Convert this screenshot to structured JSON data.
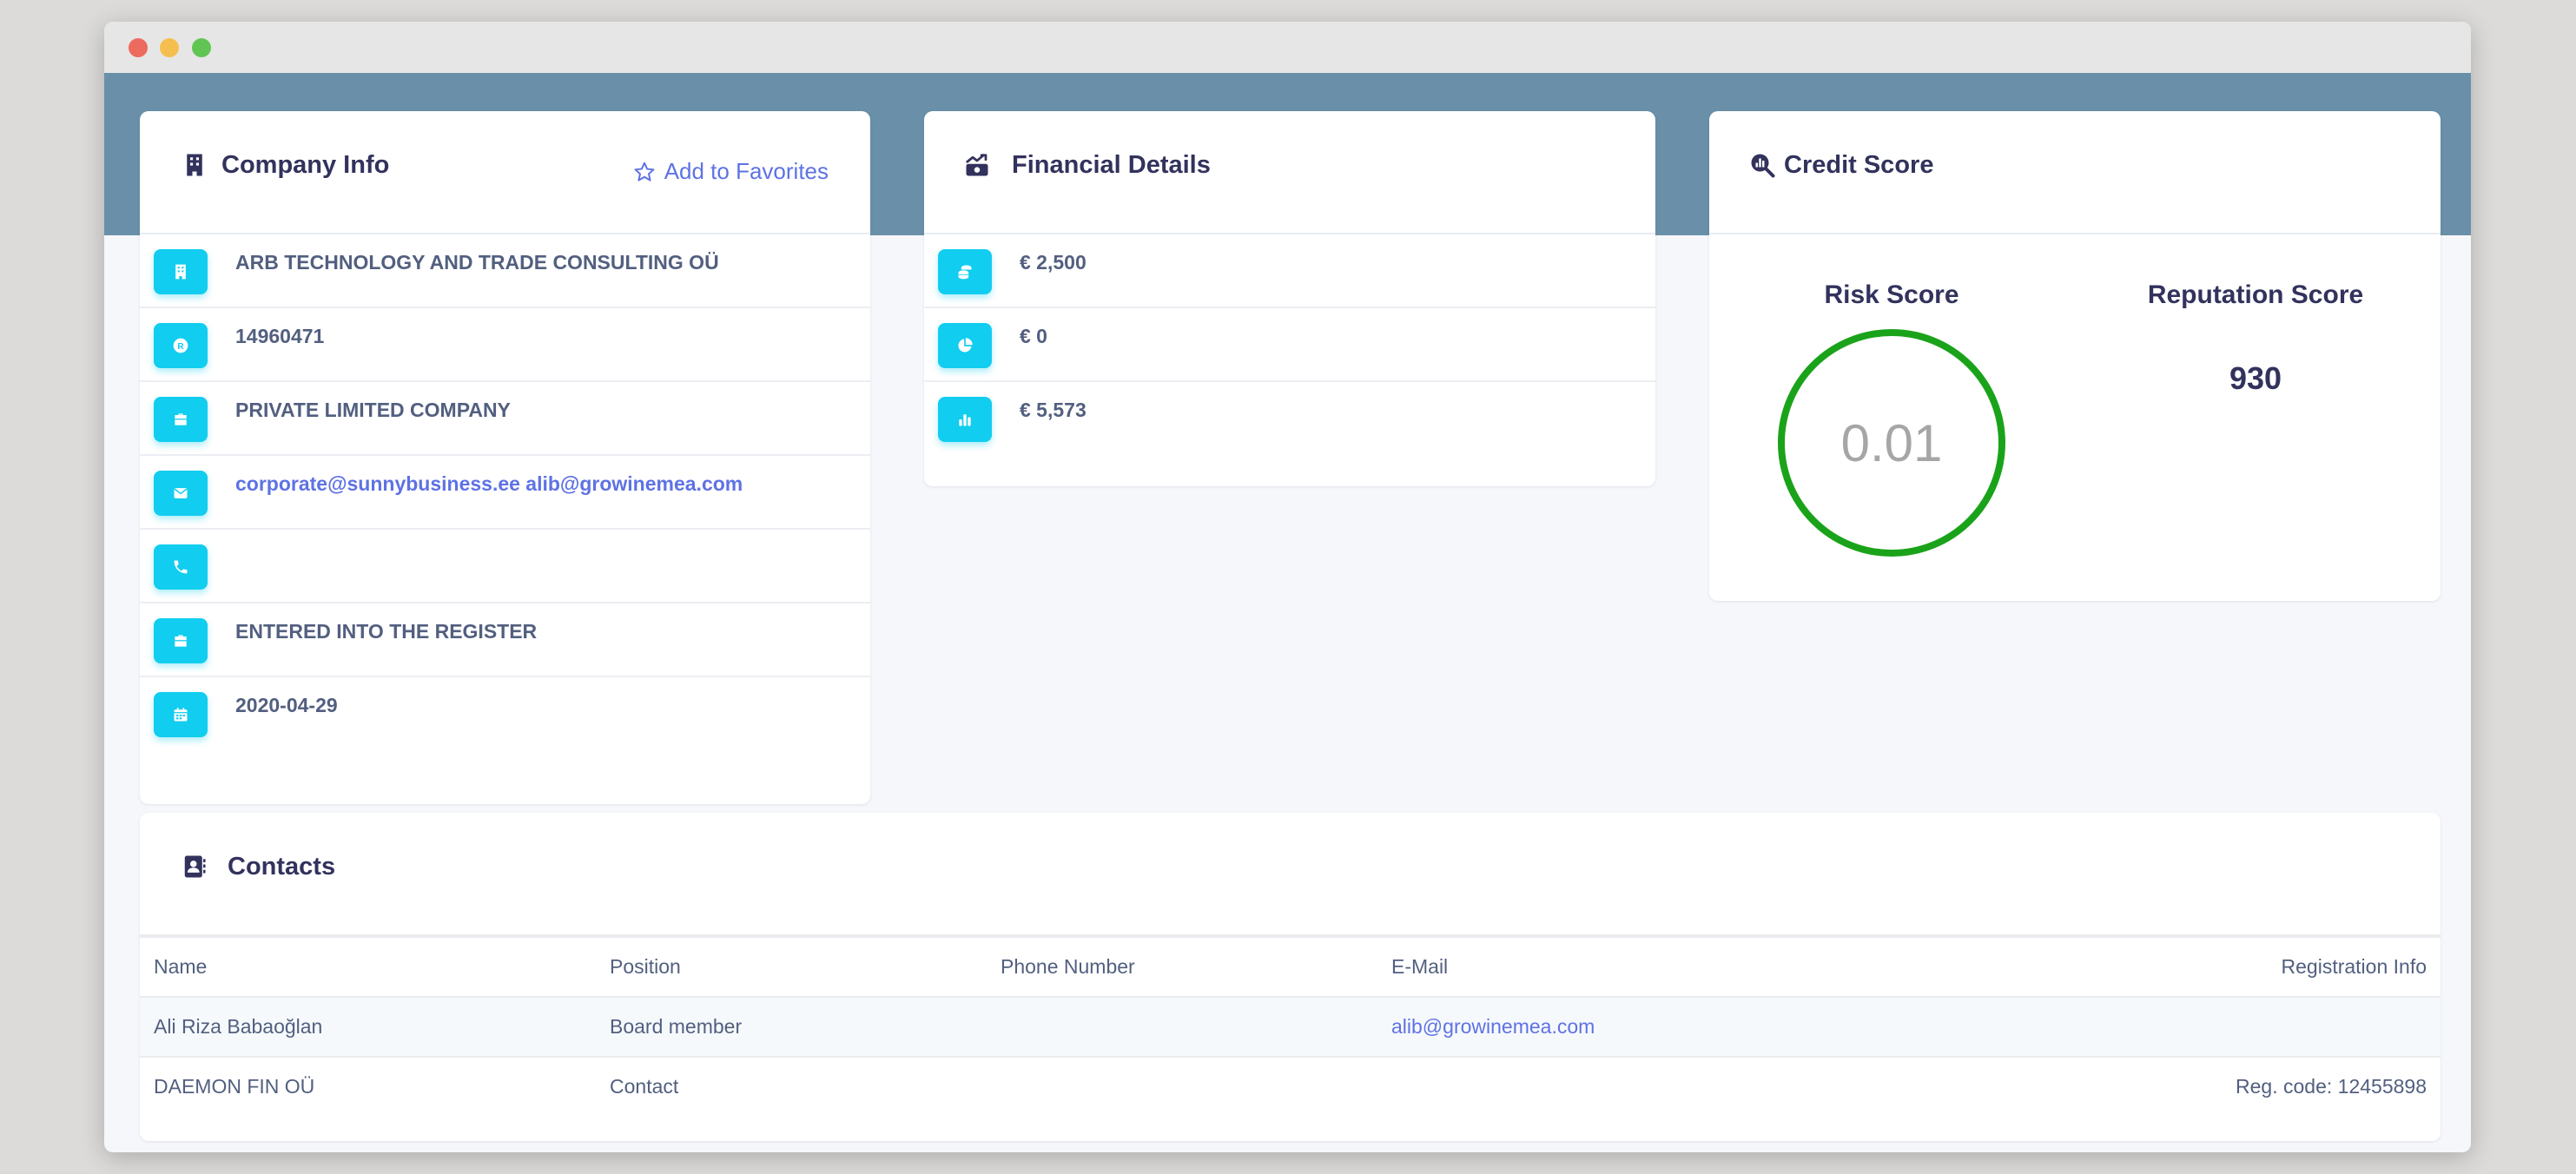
{
  "company_info": {
    "title": "Company Info",
    "favorite_label": "Add to Favorites",
    "rows": [
      {
        "icon": "building-icon",
        "value": "ARB TECHNOLOGY AND TRADE CONSULTING OÜ"
      },
      {
        "icon": "registered-icon",
        "value": "14960471"
      },
      {
        "icon": "briefcase-icon",
        "value": "PRIVATE LIMITED COMPANY"
      },
      {
        "icon": "envelope-icon",
        "value": "corporate@sunnybusiness.ee alib@growinemea.com"
      },
      {
        "icon": "phone-icon",
        "value": ""
      },
      {
        "icon": "briefcase-icon",
        "value": "ENTERED INTO THE REGISTER"
      },
      {
        "icon": "calendar-icon",
        "value": "2020-04-29"
      }
    ]
  },
  "financial_details": {
    "title": "Financial Details",
    "rows": [
      {
        "icon": "coins-icon",
        "value": "€ 2,500"
      },
      {
        "icon": "pie-chart-icon",
        "value": "€ 0"
      },
      {
        "icon": "bar-chart-icon",
        "value": "€ 5,573"
      }
    ]
  },
  "credit_score": {
    "title": "Credit Score",
    "risk_label": "Risk Score",
    "risk_value": "0.01",
    "reputation_label": "Reputation Score",
    "reputation_value": "930"
  },
  "contacts": {
    "title": "Contacts",
    "columns": [
      "Name",
      "Position",
      "Phone Number",
      "E-Mail",
      "Registration Info"
    ],
    "rows": [
      {
        "name": "Ali Riza Babaoğlan",
        "position": "Board member",
        "phone": "",
        "email": "alib@growinemea.com",
        "registration": ""
      },
      {
        "name": "DAEMON FIN OÜ",
        "position": "Contact",
        "phone": "",
        "email": "",
        "registration": "Reg. code: 12455898"
      }
    ]
  },
  "colors": {
    "accent": "#5e72e4",
    "icon_box": "#11cdef",
    "banner": "#6990a8",
    "gauge": "#1aa31a"
  }
}
